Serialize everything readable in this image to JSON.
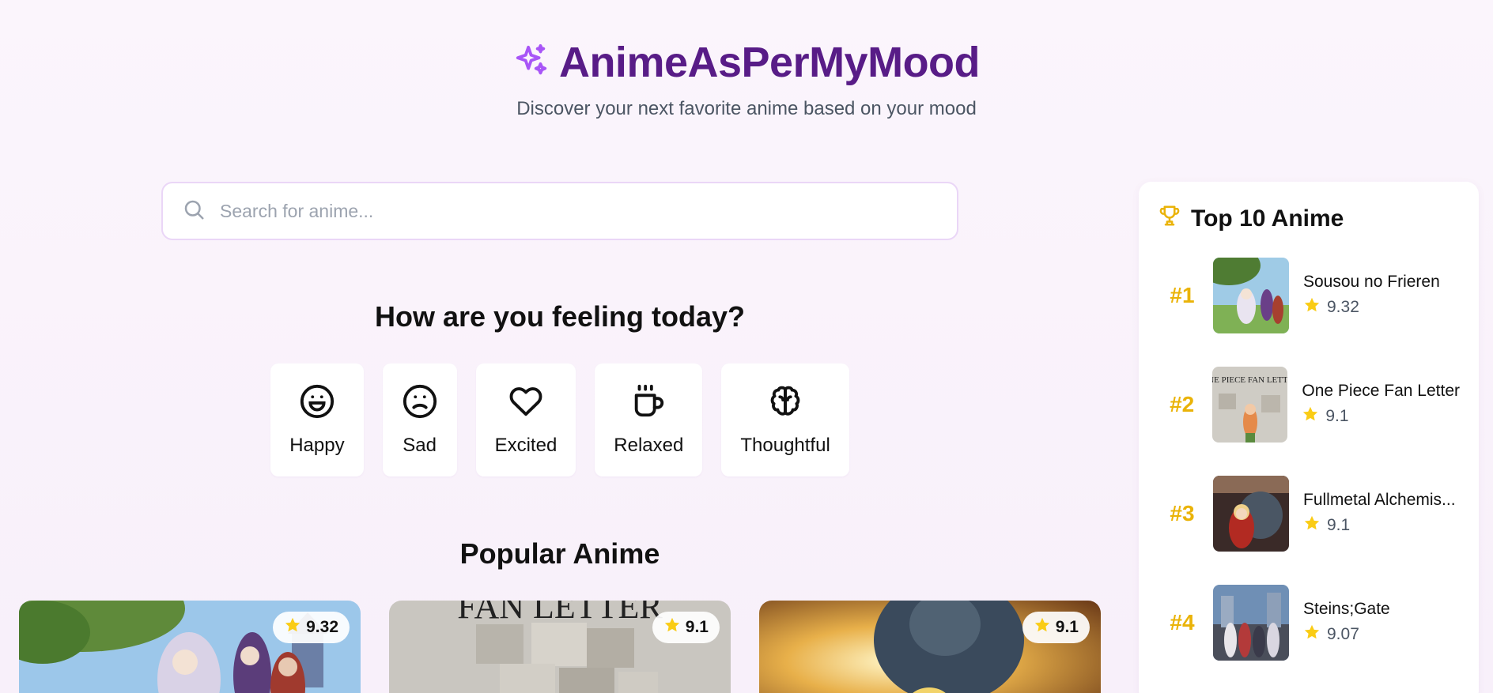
{
  "header": {
    "title": "AnimeAsPerMyMood",
    "subtitle": "Discover your next favorite anime based on your mood"
  },
  "search": {
    "placeholder": "Search for anime..."
  },
  "mood": {
    "heading": "How are you feeling today?",
    "options": [
      {
        "label": "Happy",
        "icon": "happy-face-icon"
      },
      {
        "label": "Sad",
        "icon": "sad-face-icon"
      },
      {
        "label": "Excited",
        "icon": "heart-icon"
      },
      {
        "label": "Relaxed",
        "icon": "coffee-icon"
      },
      {
        "label": "Thoughtful",
        "icon": "brain-icon"
      }
    ]
  },
  "popular": {
    "heading": "Popular Anime",
    "cards": [
      {
        "rating": "9.32"
      },
      {
        "rating": "9.1",
        "poster_text": "FAN LETTER"
      },
      {
        "rating": "9.1"
      }
    ]
  },
  "sidebar": {
    "title": "Top 10 Anime",
    "items": [
      {
        "rank": "#1",
        "name": "Sousou no Frieren",
        "score": "9.32"
      },
      {
        "rank": "#2",
        "name": "One Piece Fan Letter",
        "score": "9.1",
        "poster_text": "ONE PIECE FAN LETTER"
      },
      {
        "rank": "#3",
        "name": "Fullmetal Alchemis...",
        "score": "9.1"
      },
      {
        "rank": "#4",
        "name": "Steins;Gate",
        "score": "9.07"
      }
    ]
  },
  "colors": {
    "brand": "#581c87",
    "accent": "#a855f7",
    "gold": "#eab308",
    "star": "#facc15"
  }
}
